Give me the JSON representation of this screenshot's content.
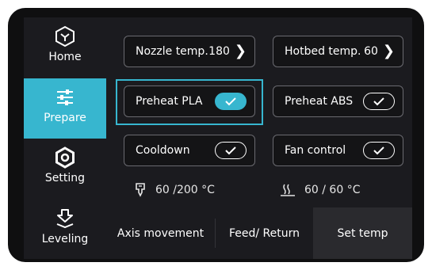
{
  "sidebar": {
    "items": [
      {
        "label": "Home",
        "icon": "home-icon",
        "active": false
      },
      {
        "label": "Prepare",
        "icon": "sliders-icon",
        "active": true
      },
      {
        "label": "Setting",
        "icon": "settings-nut-icon",
        "active": false
      },
      {
        "label": "Leveling",
        "icon": "leveling-icon",
        "active": false
      }
    ]
  },
  "cards": {
    "nozzle": {
      "label": "Nozzle temp.",
      "value": "180"
    },
    "hotbed": {
      "label": "Hotbed temp.",
      "value": "60"
    },
    "preheat_pla": {
      "label": "Preheat PLA",
      "on": true
    },
    "preheat_abs": {
      "label": "Preheat ABS",
      "on": false
    },
    "cooldown": {
      "label": "Cooldown",
      "on": false
    },
    "fan": {
      "label": "Fan control",
      "on": false
    }
  },
  "readouts": {
    "nozzle": "60 /200 °C",
    "bed": "60 / 60 °C"
  },
  "tabs": [
    {
      "label": "Axis movement",
      "active": false
    },
    {
      "label": "Feed/ Return",
      "active": false
    },
    {
      "label": "Set temp",
      "active": true
    }
  ],
  "colors": {
    "accent": "#37b6cf",
    "background": "#141416",
    "panel": "#1b1b1f",
    "border": "#6a6a70"
  }
}
